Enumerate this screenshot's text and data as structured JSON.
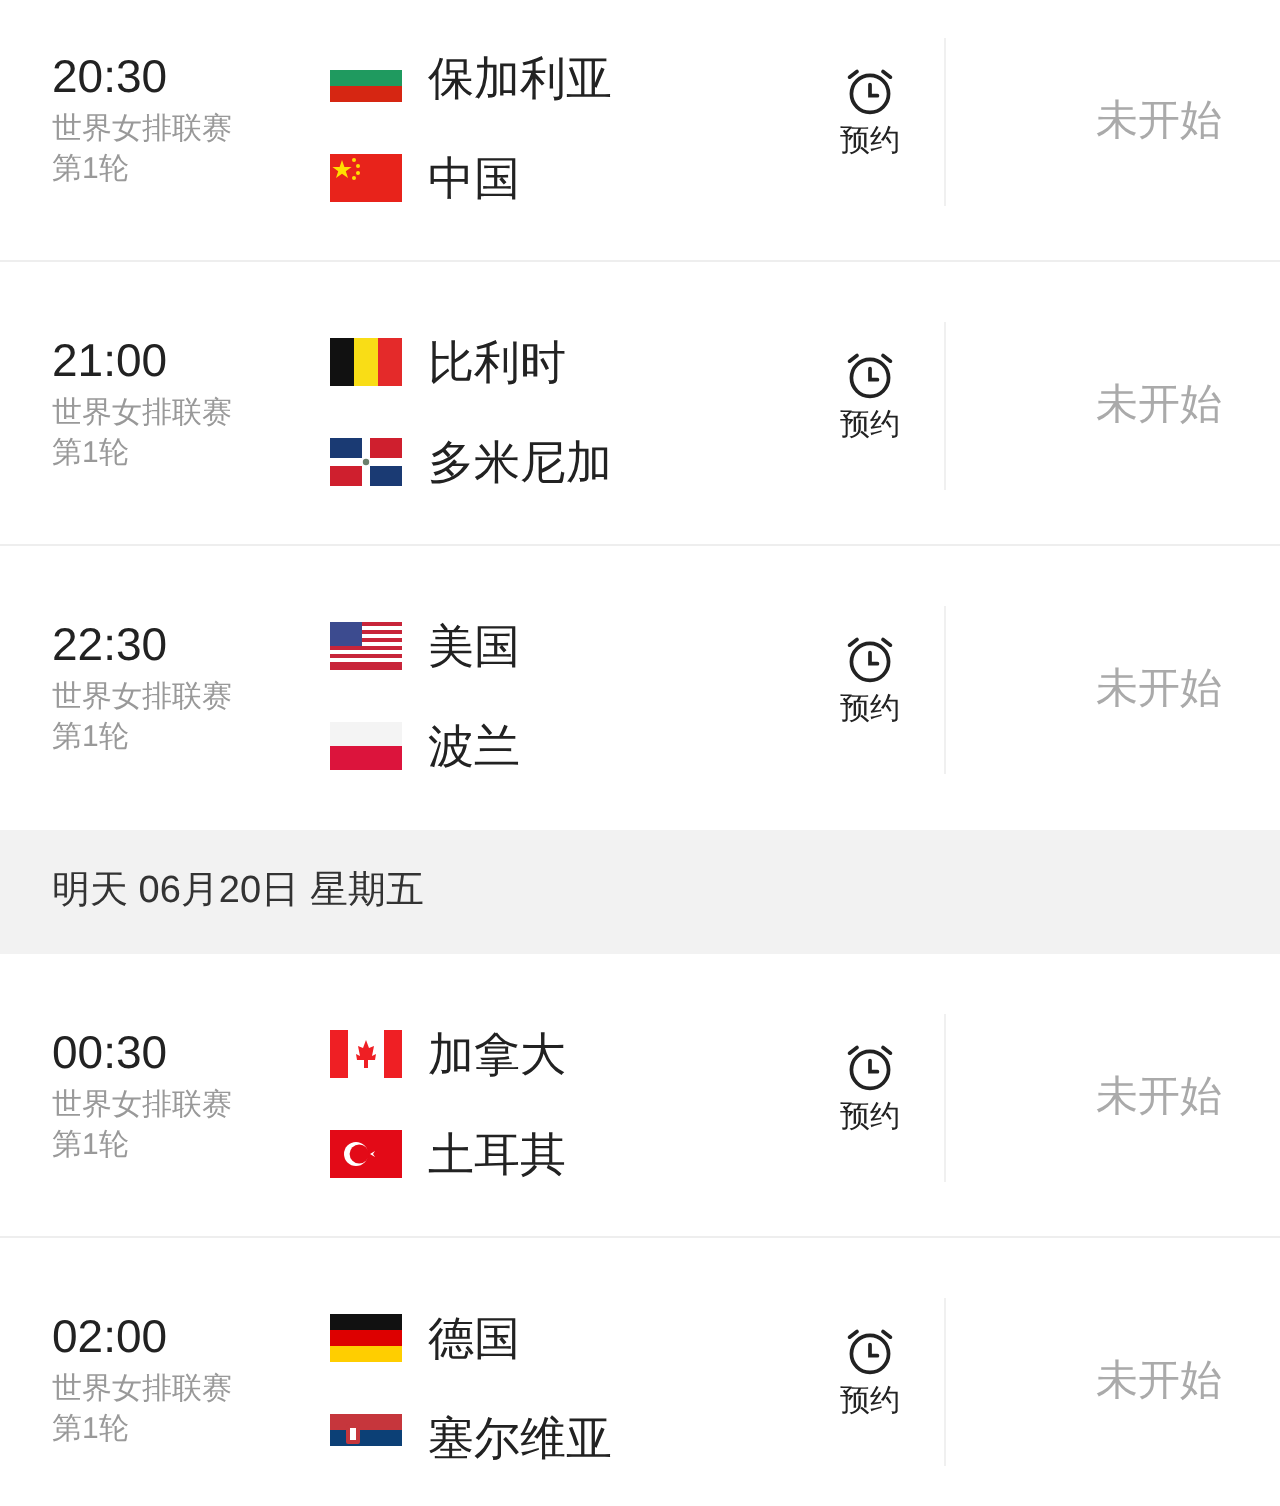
{
  "sections": [
    {
      "kind": "matches",
      "matches": [
        {
          "time": "20:30",
          "league": "世界女排联赛",
          "round": "第1轮",
          "teams": [
            {
              "name": "保加利亚",
              "kind": "bg"
            },
            {
              "name": "中国",
              "kind": "cn"
            }
          ],
          "remind": "预约",
          "status": "未开始"
        },
        {
          "time": "21:00",
          "league": "世界女排联赛",
          "round": "第1轮",
          "teams": [
            {
              "name": "比利时",
              "kind": "be"
            },
            {
              "name": "多米尼加",
              "kind": "do"
            }
          ],
          "remind": "预约",
          "status": "未开始"
        },
        {
          "time": "22:30",
          "league": "世界女排联赛",
          "round": "第1轮",
          "teams": [
            {
              "name": "美国",
              "kind": "us"
            },
            {
              "name": "波兰",
              "kind": "pl"
            }
          ],
          "remind": "预约",
          "status": "未开始"
        }
      ]
    },
    {
      "kind": "date",
      "label": "明天 06月20日 星期五"
    },
    {
      "kind": "matches",
      "matches": [
        {
          "time": "00:30",
          "league": "世界女排联赛",
          "round": "第1轮",
          "teams": [
            {
              "name": "加拿大",
              "kind": "ca"
            },
            {
              "name": "土耳其",
              "kind": "tr"
            }
          ],
          "remind": "预约",
          "status": "未开始"
        },
        {
          "time": "02:00",
          "league": "世界女排联赛",
          "round": "第1轮",
          "teams": [
            {
              "name": "德国",
              "kind": "de"
            },
            {
              "name": "塞尔维亚",
              "kind": "rs"
            }
          ],
          "remind": "预约",
          "status": "未开始"
        }
      ]
    }
  ]
}
